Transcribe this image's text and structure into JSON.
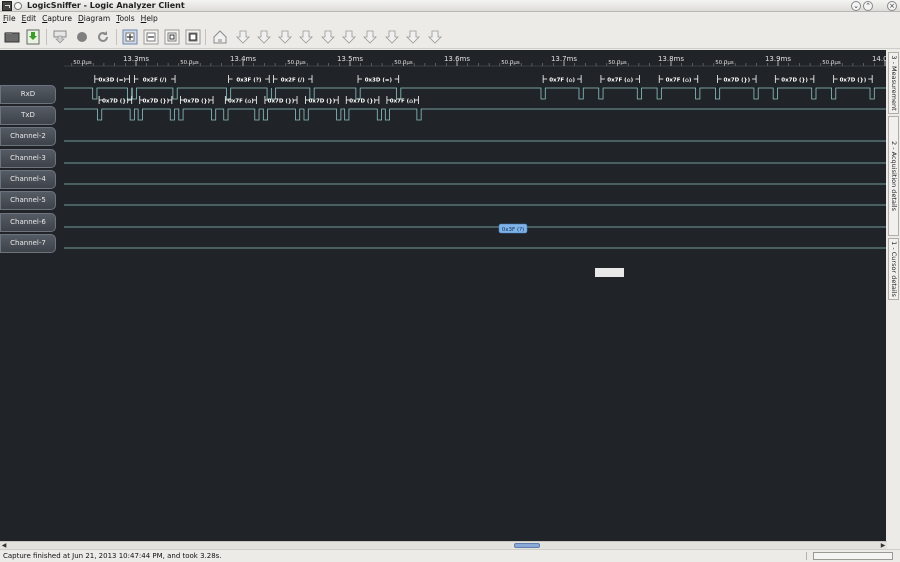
{
  "window": {
    "title": "LogicSniffer - Logic Analyzer Client"
  },
  "menu": [
    "File",
    "Edit",
    "Capture",
    "Diagram",
    "Tools",
    "Help"
  ],
  "menu_mnemonics": [
    "F",
    "E",
    "C",
    "D",
    "T",
    "H"
  ],
  "toolbar": {
    "buttons": [
      {
        "name": "open-file-icon"
      },
      {
        "name": "save-file-icon"
      },
      {
        "name": "capture-icon"
      },
      {
        "name": "stop-icon"
      },
      {
        "name": "repeat-capture-icon"
      },
      {
        "name": "zoom-in-icon"
      },
      {
        "name": "zoom-out-icon"
      },
      {
        "name": "zoom-original-icon"
      },
      {
        "name": "zoom-all-icon"
      },
      {
        "name": "go-to-trigger-icon"
      },
      {
        "name": "cursor-1-icon"
      },
      {
        "name": "cursor-2-icon"
      },
      {
        "name": "cursor-3-icon"
      },
      {
        "name": "cursor-4-icon"
      },
      {
        "name": "cursor-5-icon"
      },
      {
        "name": "cursor-6-icon"
      },
      {
        "name": "cursor-7-icon"
      },
      {
        "name": "cursor-8-icon"
      },
      {
        "name": "cursor-9-icon"
      },
      {
        "name": "cursor-10-icon"
      }
    ]
  },
  "timeline": {
    "major": [
      {
        "label": "13.3ms",
        "t": 13.3
      },
      {
        "label": "13.4ms",
        "t": 13.4
      },
      {
        "label": "13.5ms",
        "t": 13.5
      },
      {
        "label": "13.6ms",
        "t": 13.6
      },
      {
        "label": "13.7ms",
        "t": 13.7
      },
      {
        "label": "13.8ms",
        "t": 13.8
      },
      {
        "label": "13.9ms",
        "t": 13.9
      },
      {
        "label": "14.0ms",
        "t": 14.0
      }
    ],
    "half_label": "50.0µs"
  },
  "channels": [
    "RxD",
    "TxD",
    "Channel-2",
    "Channel-3",
    "Channel-4",
    "Channel-5",
    "Channel-6",
    "Channel-7"
  ],
  "rxd_annotations": [
    {
      "text": "0x3D (=)",
      "t0": 13.2615,
      "t1": 13.294
    },
    {
      "text": "0x2F (/)",
      "t0": 13.2985,
      "t1": 13.3365
    },
    {
      "text": "0x3F (?)",
      "t0": 13.3865,
      "t1": 13.4245
    },
    {
      "text": "0x2F (/)",
      "t0": 13.4285,
      "t1": 13.4645
    },
    {
      "text": "0x3D (=)",
      "t0": 13.5075,
      "t1": 13.5455
    },
    {
      "text": "0x7F (⌂)",
      "t0": 13.6805,
      "t1": 13.716
    },
    {
      "text": "0x7F (⌂)",
      "t0": 13.7345,
      "t1": 13.7705
    },
    {
      "text": "0x7F (⌂)",
      "t0": 13.789,
      "t1": 13.825
    },
    {
      "text": "0x7D (})",
      "t0": 13.8435,
      "t1": 13.8795
    },
    {
      "text": "0x7D (})",
      "t0": 13.8975,
      "t1": 13.9335
    },
    {
      "text": "0x7D (})",
      "t0": 13.952,
      "t1": 13.988
    },
    {
      "text": "0x7D (})",
      "t0": 14.006,
      "t1": 14.042
    }
  ],
  "txd_annotations": [
    {
      "text": "0x7D (})",
      "t0": 13.2655,
      "t1": 13.296
    },
    {
      "text": "0x7D (})",
      "t0": 13.3035,
      "t1": 13.3335
    },
    {
      "text": "0x7D (})",
      "t0": 13.3415,
      "t1": 13.372
    },
    {
      "text": "0x7F (⌂)",
      "t0": 13.3835,
      "t1": 13.4125
    },
    {
      "text": "0x7D (})",
      "t0": 13.4205,
      "t1": 13.4505
    },
    {
      "text": "0x7D (})",
      "t0": 13.4585,
      "t1": 13.489
    },
    {
      "text": "0x7D (})",
      "t0": 13.4965,
      "t1": 13.527
    },
    {
      "text": "0x7F (⌂)",
      "t0": 13.5345,
      "t1": 13.564
    }
  ],
  "hover_tooltip": "0x3F (?)",
  "status": {
    "text": "Capture finished at Jun 21, 2013 10:47:44 PM, and took 3.28s."
  },
  "side_tabs": [
    "3 - Measurement",
    "2 - Acquisition details",
    "1 - Cursor details"
  ],
  "colors": {
    "background": "#202327",
    "signal": "#8fc5c5",
    "annotation": "#ffffff",
    "tooltip": "#7fb3e8"
  }
}
